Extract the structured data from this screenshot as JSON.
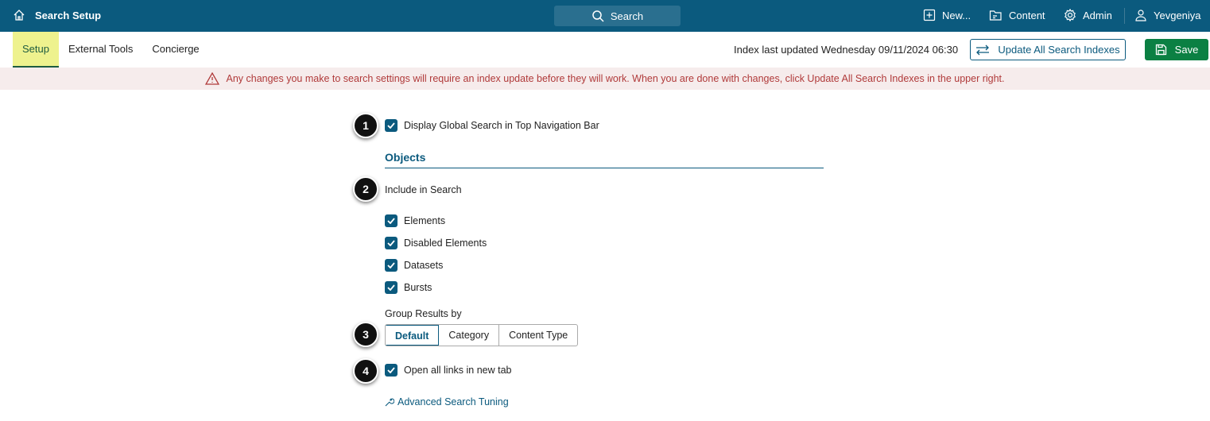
{
  "header": {
    "title": "Search Setup",
    "search_label": "Search",
    "nav": [
      {
        "label": "New...",
        "icon": "plus-square-icon"
      },
      {
        "label": "Content",
        "icon": "folder-icon"
      },
      {
        "label": "Admin",
        "icon": "gear-icon"
      },
      {
        "label": "Yevgeniya",
        "icon": "user-icon"
      }
    ]
  },
  "tabs": [
    {
      "label": "Setup",
      "active": true
    },
    {
      "label": "External Tools"
    },
    {
      "label": "Concierge"
    }
  ],
  "toolbar": {
    "index_status": "Index last updated Wednesday 09/11/2024 06:30",
    "update_label": "Update All Search Indexes",
    "save_label": "Save"
  },
  "warning": "Any changes you make to search settings will require an index update before they will work. When you are done with changes, click Update All Search Indexes in the upper right.",
  "form": {
    "display_global": "Display Global Search in Top Navigation Bar",
    "section": "Objects",
    "include_label": "Include in Search",
    "include_items": [
      "Elements",
      "Disabled Elements",
      "Datasets",
      "Bursts"
    ],
    "group_label": "Group Results by",
    "group_options": [
      "Default",
      "Category",
      "Content Type"
    ],
    "group_selected": "Default",
    "open_links": "Open all links in new tab",
    "advanced_link": "Advanced Search Tuning"
  },
  "badges": [
    "1",
    "2",
    "3",
    "4"
  ]
}
